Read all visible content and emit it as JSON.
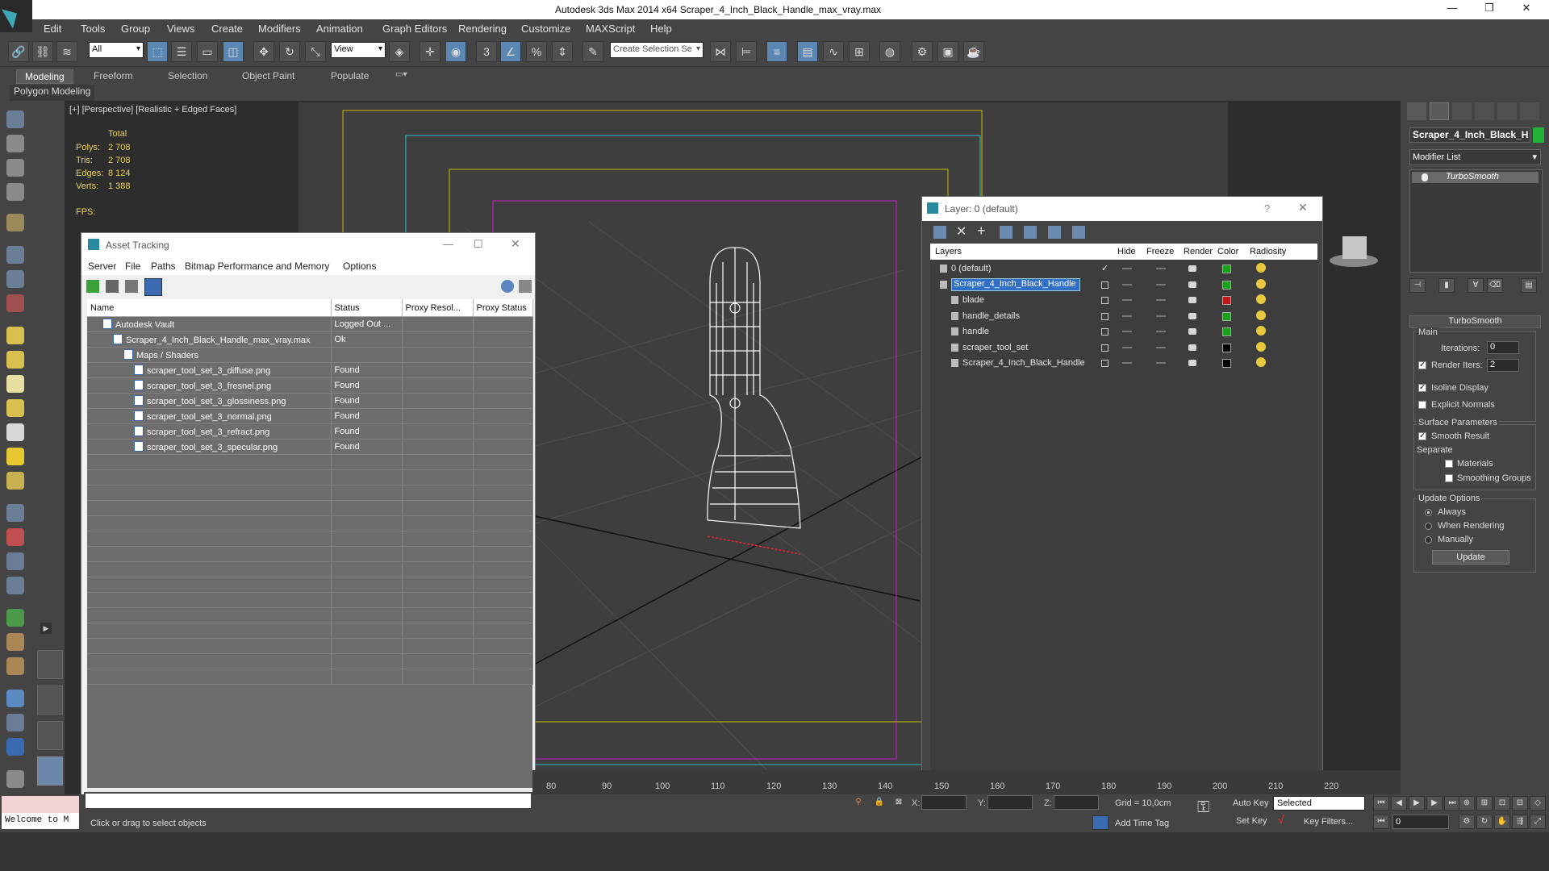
{
  "title_bar": {
    "title": "Autodesk 3ds Max  2014 x64    Scraper_4_Inch_Black_Handle_max_vray.max",
    "minimize": "—",
    "maximize": "❐",
    "close": "✕"
  },
  "menu": [
    "Edit",
    "Tools",
    "Group",
    "Views",
    "Create",
    "Modifiers",
    "Animation",
    "Graph Editors",
    "Rendering",
    "Customize",
    "MAXScript",
    "Help"
  ],
  "toolbar": {
    "selection_filter": "All",
    "reference_coord": "View",
    "snap_3": "3",
    "selection_set_placeholder": "Create Selection Se"
  },
  "ribbon": {
    "tabs": [
      "Modeling",
      "Freeform",
      "Selection",
      "Object Paint",
      "Populate"
    ],
    "panel_label": "Polygon Modeling"
  },
  "viewport": {
    "label": "[+] [Perspective] [Realistic + Edged Faces]",
    "stats": {
      "total_label": "Total",
      "polys_label": "Polys:",
      "polys": "2 708",
      "tris_label": "Tris:",
      "tris": "2 708",
      "edges_label": "Edges:",
      "edges": "8 124",
      "verts_label": "Verts:",
      "verts": "1 388",
      "fps_label": "FPS:"
    }
  },
  "asset_tracking": {
    "title": "Asset Tracking",
    "menu": [
      "Server",
      "File",
      "Paths",
      "Bitmap Performance and Memory",
      "Options"
    ],
    "columns": [
      "Name",
      "Status",
      "Proxy Resol...",
      "Proxy Status"
    ],
    "rows": [
      {
        "name": "Autodesk Vault",
        "status": "Logged Out ...",
        "indent": 1,
        "icon": "vault-icon"
      },
      {
        "name": "Scraper_4_Inch_Black_Handle_max_vray.max",
        "status": "Ok",
        "indent": 2,
        "icon": "max-file-icon"
      },
      {
        "name": "Maps / Shaders",
        "status": "",
        "indent": 3,
        "icon": "maps-icon"
      },
      {
        "name": "scraper_tool_set_3_diffuse.png",
        "status": "Found",
        "indent": 4,
        "icon": "bitmap-icon"
      },
      {
        "name": "scraper_tool_set_3_fresnel.png",
        "status": "Found",
        "indent": 4,
        "icon": "bitmap-icon"
      },
      {
        "name": "scraper_tool_set_3_glossiness.png",
        "status": "Found",
        "indent": 4,
        "icon": "bitmap-icon"
      },
      {
        "name": "scraper_tool_set_3_normal.png",
        "status": "Found",
        "indent": 4,
        "icon": "bitmap-icon"
      },
      {
        "name": "scraper_tool_set_3_refract.png",
        "status": "Found",
        "indent": 4,
        "icon": "bitmap-icon"
      },
      {
        "name": "scraper_tool_set_3_specular.png",
        "status": "Found",
        "indent": 4,
        "icon": "bitmap-icon"
      }
    ]
  },
  "layers": {
    "title": "Layer: 0 (default)",
    "help": "?",
    "columns": [
      "Layers",
      "Hide",
      "Freeze",
      "Render",
      "Color",
      "Radiosity"
    ],
    "rows": [
      {
        "name": "0 (default)",
        "indent": 0,
        "color": "#1aa01a",
        "checked": true,
        "selected": false
      },
      {
        "name": "Scraper_4_Inch_Black_Handle",
        "indent": 0,
        "color": "#1aa01a",
        "checked": false,
        "selected": true
      },
      {
        "name": "blade",
        "indent": 1,
        "color": "#c01818",
        "checked": false,
        "selected": false
      },
      {
        "name": "handle_details",
        "indent": 1,
        "color": "#1aa01a",
        "checked": false,
        "selected": false
      },
      {
        "name": "handle",
        "indent": 1,
        "color": "#1aa01a",
        "checked": false,
        "selected": false
      },
      {
        "name": "scraper_tool_set",
        "indent": 1,
        "color": "#000000",
        "checked": false,
        "selected": false
      },
      {
        "name": "Scraper_4_Inch_Black_Handle",
        "indent": 1,
        "color": "#000000",
        "checked": false,
        "selected": false
      }
    ]
  },
  "command_panel": {
    "object_name": "Scraper_4_Inch_Black_H",
    "object_color": "#23b33a",
    "modifier_list": "Modifier List",
    "stack_entry": "TurboSmooth",
    "rollout_title": "TurboSmooth",
    "main_label": "Main",
    "iterations_label": "Iterations:",
    "iterations": "0",
    "render_iters_label": "Render Iters:",
    "render_iters": "2",
    "isoline_label": "Isoline Display",
    "explicit_normals_label": "Explicit Normals",
    "surface_params_label": "Surface Parameters",
    "smooth_result_label": "Smooth Result",
    "separate_label": "Separate",
    "materials_label": "Materials",
    "smoothing_groups_label": "Smoothing Groups",
    "update_options_label": "Update Options",
    "always_label": "Always",
    "when_rendering_label": "When Rendering",
    "manually_label": "Manually",
    "update_button": "Update"
  },
  "timeline": {
    "ticks": [
      "80",
      "90",
      "100",
      "110",
      "120",
      "130",
      "140",
      "150",
      "160",
      "170",
      "180",
      "190",
      "200",
      "210",
      "220"
    ]
  },
  "status": {
    "welcome": "Welcome to M",
    "hint": "Click or drag to select objects",
    "x_label": "X:",
    "y_label": "Y:",
    "z_label": "Z:",
    "grid": "Grid = 10,0cm",
    "add_time_tag": "Add Time Tag",
    "auto_key": "Auto Key",
    "set_key": "Set Key",
    "selected": "Selected",
    "key_filters": "Key Filters...",
    "frame": "0"
  }
}
